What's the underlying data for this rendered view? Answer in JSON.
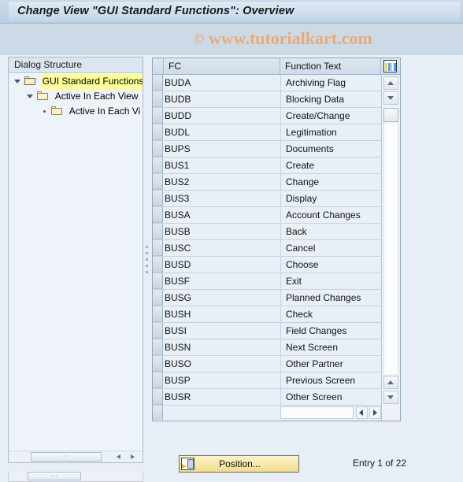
{
  "window": {
    "title": "Change View \"GUI Standard Functions\": Overview"
  },
  "watermark": {
    "copyright_symbol": "©",
    "text": "www.tutorialkart.com"
  },
  "sidebar": {
    "header": "Dialog Structure",
    "items": [
      {
        "label": "GUI Standard Functions",
        "level": 0,
        "expander": "down",
        "folder": "open",
        "selected": true
      },
      {
        "label": "Active In Each View",
        "level": 1,
        "expander": "down",
        "folder": "closed",
        "selected": false
      },
      {
        "label": "Active In Each Vi",
        "level": 2,
        "expander": "dot",
        "folder": "closed",
        "selected": false
      }
    ]
  },
  "table": {
    "columns": [
      "FC",
      "Function Text"
    ],
    "config_icon": "column-settings-icon",
    "rows": [
      {
        "fc": "BUDA",
        "text": "Archiving Flag"
      },
      {
        "fc": "BUDB",
        "text": "Blocking Data"
      },
      {
        "fc": "BUDD",
        "text": "Create/Change"
      },
      {
        "fc": "BUDL",
        "text": "Legitimation"
      },
      {
        "fc": "BUPS",
        "text": "Documents"
      },
      {
        "fc": "BUS1",
        "text": "Create"
      },
      {
        "fc": "BUS2",
        "text": "Change"
      },
      {
        "fc": "BUS3",
        "text": "Display"
      },
      {
        "fc": "BUSA",
        "text": "Account Changes"
      },
      {
        "fc": "BUSB",
        "text": "Back"
      },
      {
        "fc": "BUSC",
        "text": "Cancel"
      },
      {
        "fc": "BUSD",
        "text": "Choose"
      },
      {
        "fc": "BUSF",
        "text": "Exit"
      },
      {
        "fc": "BUSG",
        "text": "Planned Changes"
      },
      {
        "fc": "BUSH",
        "text": "Check"
      },
      {
        "fc": "BUSI",
        "text": "Field Changes"
      },
      {
        "fc": "BUSN",
        "text": "Next Screen"
      },
      {
        "fc": "BUSO",
        "text": "Other Partner"
      },
      {
        "fc": "BUSP",
        "text": "Previous Screen"
      },
      {
        "fc": "BUSR",
        "text": "Other Screen"
      }
    ]
  },
  "footer": {
    "position_button": "Position...",
    "entry_status": "Entry 1 of 22"
  },
  "colors": {
    "titlebar": "#c9d9e8",
    "watermark": "#eaab73",
    "tree_selection": "#ffff99",
    "button_yellow": "#f7e9a8",
    "grid_row": "#e9eff6"
  }
}
